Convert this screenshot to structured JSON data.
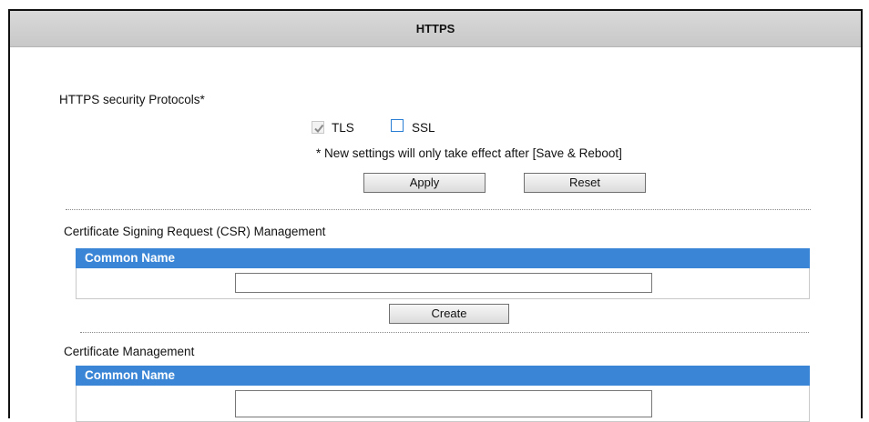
{
  "page": {
    "title": "HTTPS"
  },
  "protocols": {
    "heading": "HTTPS security Protocols*",
    "options": [
      {
        "label": "TLS",
        "checked": true
      },
      {
        "label": "SSL",
        "checked": false
      }
    ],
    "note": "* New settings will only take effect after [Save & Reboot]",
    "apply_label": "Apply",
    "reset_label": "Reset"
  },
  "csr": {
    "heading": "Certificate Signing Request (CSR) Management",
    "column_header": "Common Name",
    "common_name_value": "",
    "create_label": "Create"
  },
  "certificate": {
    "heading": "Certificate Management",
    "column_header": "Common Name",
    "common_name_value": ""
  }
}
